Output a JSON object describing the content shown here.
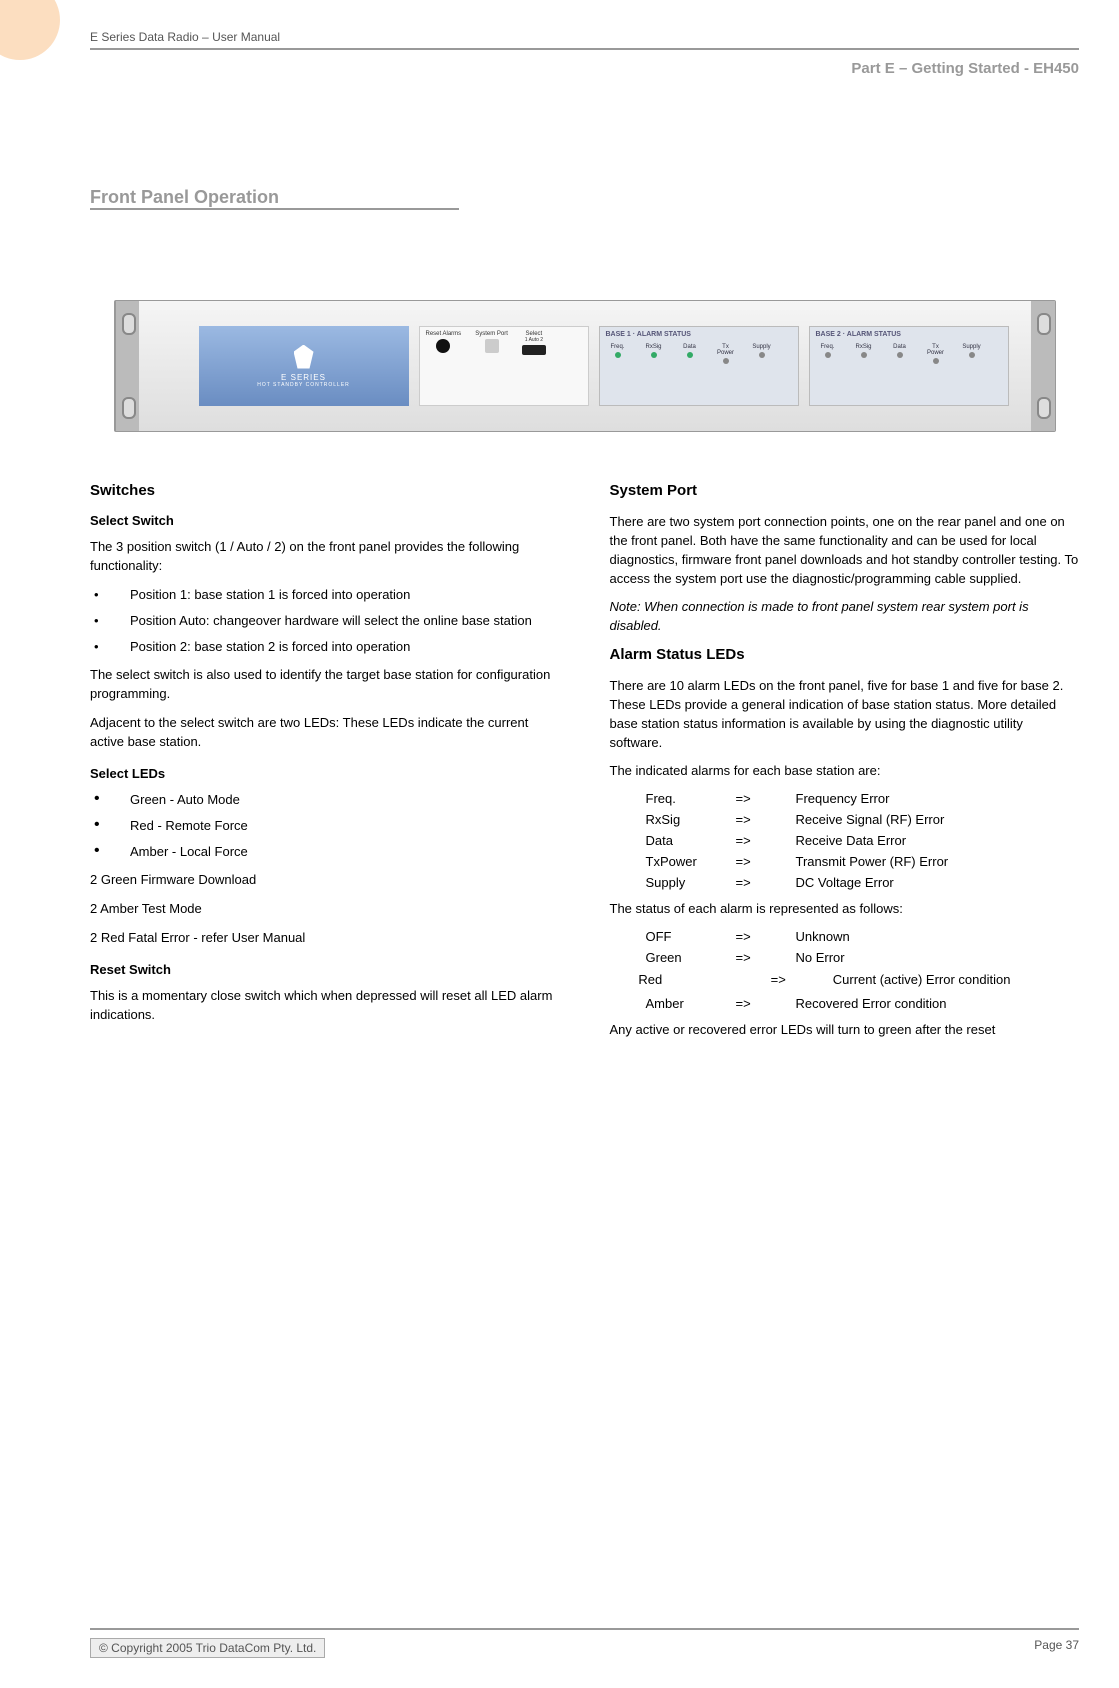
{
  "header": {
    "running_title": "E Series Data Radio – User Manual",
    "part_label": "Part E –  Getting Started - EH450"
  },
  "section_title": "Front Panel Operation",
  "device": {
    "brand_line1": "E SERIES",
    "brand_line2": "HOT STANDBY CONTROLLER",
    "panel": {
      "reset": "Reset\nAlarms",
      "system": "System\nPort",
      "select": "Select",
      "positions": "1   Auto   2"
    },
    "base1": {
      "title": "BASE 1",
      "sub": "ALARM STATUS",
      "leds": [
        "Freq.",
        "RxSig",
        "Data",
        "Tx Power",
        "Supply"
      ]
    },
    "base2": {
      "title": "BASE 2",
      "sub": "ALARM STATUS",
      "leds": [
        "Freq.",
        "RxSig",
        "Data",
        "Tx Power",
        "Supply"
      ]
    }
  },
  "left": {
    "h_switches": "Switches",
    "h_select_switch": "Select Switch",
    "p_intro": "The 3 position switch (1 / Auto / 2) on the front panel provides the following functionality:",
    "positions": [
      "Position 1: base station 1 is forced into operation",
      "Position Auto: changeover hardware will select the online base station",
      "Position 2: base station 2 is forced into operation"
    ],
    "p_identify": "The select switch is also used to identify the target base station for configuration programming.",
    "p_adjacent": "Adjacent to the select switch are two LEDs: These LEDs indicate the current active base station.",
    "h_select_leds": "Select LEDs",
    "led_items": [
      "Green - Auto Mode",
      "Red - Remote Force",
      "Amber - Local Force"
    ],
    "led_lines": [
      "2 Green Firmware Download",
      "2 Amber Test Mode",
      "2 Red Fatal Error - refer User Manual"
    ],
    "h_reset": "Reset Switch",
    "p_reset": "This is a momentary close switch which when depressed will reset all LED alarm indications."
  },
  "right": {
    "h_system_port": "System Port",
    "p_system_port": "There are two system port connection points, one on the rear panel and one on the front panel. Both have the same functionality and can be used for local diagnostics, firmware front panel downloads and hot standby controller testing. To access the system port use the diagnostic/programming cable supplied.",
    "p_note": "Note: When connection is made to front panel system rear system port is disabled.",
    "h_alarm": "Alarm Status LEDs",
    "p_alarm_intro": "There are 10 alarm LEDs on the front panel, five for base 1 and five for base 2. These LEDs provide a general indication of base station status. More detailed base station status information is available by using the diagnostic utility software.",
    "p_alarm_list_intro": "The indicated alarms for each base station are:",
    "alarm_map": [
      {
        "name": "Freq.",
        "arrow": "=>",
        "desc": "Frequency Error"
      },
      {
        "name": "RxSig",
        "arrow": "=>",
        "desc": "Receive Signal (RF) Error"
      },
      {
        "name": "Data",
        "arrow": "=>",
        "desc": "Receive Data Error"
      },
      {
        "name": "TxPower",
        "arrow": "=>",
        "desc": "Transmit Power (RF) Error"
      },
      {
        "name": "Supply",
        "arrow": "=>",
        "desc": "DC Voltage Error"
      }
    ],
    "p_status_intro": "The status of each alarm is represented as follows:",
    "status_map": [
      {
        "name": "OFF",
        "arrow": "=>",
        "desc": "Unknown"
      },
      {
        "name": "Green",
        "arrow": "=>",
        "desc": " No Error"
      }
    ],
    "status_red_line": "        Red                              =>             Current (active) Error condition",
    "status_amber": {
      "name": "Amber",
      "arrow": "=>",
      "desc": "Recovered Error condition"
    },
    "p_trailing": "Any active or recovered error LEDs will turn to green after the reset"
  },
  "footer": {
    "copyright": "© Copyright 2005 Trio DataCom Pty. Ltd.",
    "page": "Page 37"
  }
}
